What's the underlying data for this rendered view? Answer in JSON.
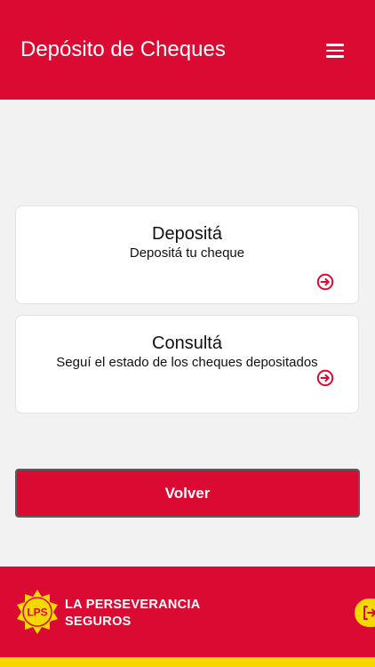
{
  "header": {
    "title": "Depósito de Cheques",
    "menu_icon": "hamburger-menu-icon"
  },
  "cards": [
    {
      "title": "Depositá",
      "subtitle": "Depositá tu cheque",
      "icon": "arrow-right-circle-icon"
    },
    {
      "title": "Consultá",
      "subtitle": "Seguí el estado de los cheques depositados",
      "icon": "arrow-right-circle-icon"
    }
  ],
  "volver_label": "Volver",
  "footer": {
    "logo_text": "LPS",
    "brand_line1": "LA PERSEVERANCIA",
    "brand_line2": "SEGUROS",
    "logout_icon": "logout-icon"
  },
  "colors": {
    "primary": "#db0a32",
    "accent": "#f5d800",
    "background": "#f2f2f2"
  }
}
